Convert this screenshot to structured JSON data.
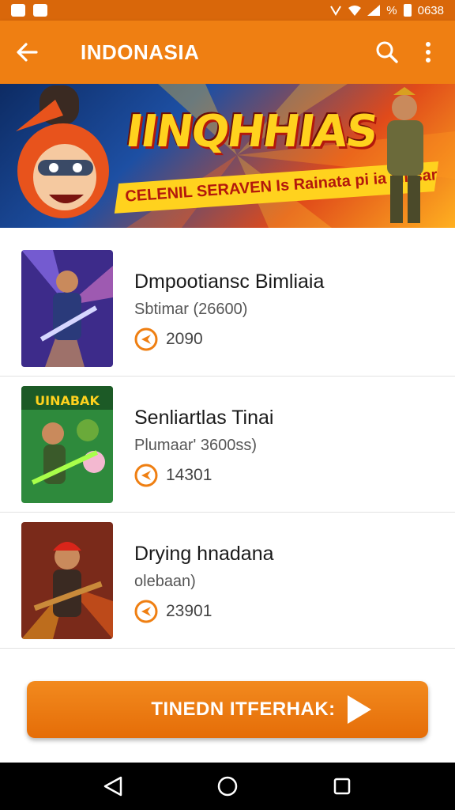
{
  "status_bar": {
    "time": "0638",
    "battery_text": "%",
    "icons": [
      "gallery-app-icon",
      "camera-app-icon",
      "nfc-icon",
      "wifi-icon",
      "signal-icon",
      "battery-icon"
    ]
  },
  "app_bar": {
    "title": "INDONASIA",
    "icons": [
      "back-arrow-icon",
      "search-icon",
      "more-vert-icon"
    ]
  },
  "banner": {
    "title": "IINQHHIAS",
    "subtitle": "CELENIL SERAVEN Is Rainata pi ia siitsar"
  },
  "list": {
    "items": [
      {
        "title": "Dmpootiansc Bimliaia",
        "subtitle": "Sbtimar (26600)",
        "stat": "2090",
        "thumb_icon": "game-thumbnail-icon"
      },
      {
        "title": "Senliartlas Tinai",
        "subtitle": "Plumaar' 3600ss)",
        "stat": "14301",
        "thumb_icon": "game-thumbnail-icon",
        "thumb_label": "UINABAK"
      },
      {
        "title": "Drying hnadana",
        "subtitle": "olebaan)",
        "stat": "23901",
        "thumb_icon": "game-thumbnail-icon"
      }
    ]
  },
  "cta": {
    "label": "TINEDN ITFERHAK:",
    "icon": "play-icon"
  },
  "nav_bar": {
    "icons": [
      "back-nav-icon",
      "home-nav-icon",
      "recents-nav-icon"
    ]
  },
  "colors": {
    "primary": "#ef7f12",
    "status": "#d9670a",
    "accent_yellow": "#ffd21e"
  }
}
